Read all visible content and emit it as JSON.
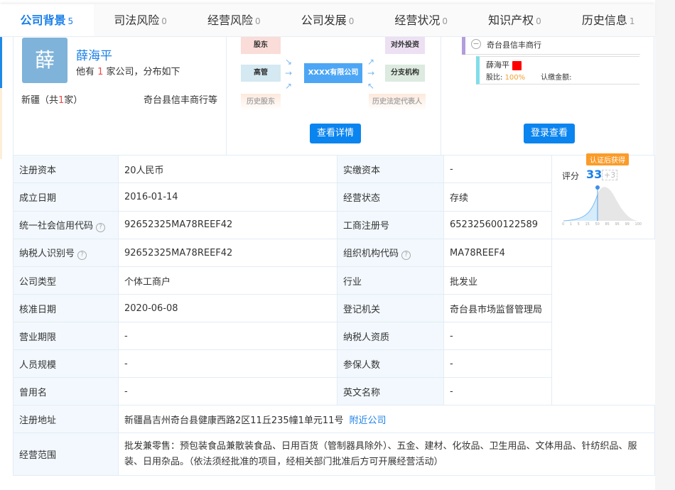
{
  "tabs": [
    {
      "label": "公司背景",
      "count": "5"
    },
    {
      "label": "司法风险",
      "count": "0"
    },
    {
      "label": "经营风险",
      "count": "0"
    },
    {
      "label": "公司发展",
      "count": "0"
    },
    {
      "label": "经营状况",
      "count": "0"
    },
    {
      "label": "知识产权",
      "count": "0"
    },
    {
      "label": "历史信息",
      "count": "1"
    }
  ],
  "person": {
    "avatar": "薛",
    "name": "薛海平",
    "desc_pre": "他有 ",
    "count": "1",
    "desc_post": " 家公司，分布如下",
    "region_pre": "新疆（共",
    "region_count": "1",
    "region_post": "家）",
    "companies": "奇台县信丰商行等"
  },
  "graph": {
    "shareholder": "股东",
    "executive": "高管",
    "history_shareholder": "历史股东",
    "center": "XXXX有限公司",
    "investment": "对外投资",
    "branch": "分支机构",
    "history_rep": "历史法定代表人",
    "button": "查看详情"
  },
  "equity": {
    "company": "奇台县信丰商行",
    "holder": "薛海平",
    "ratio_label": "股比: ",
    "ratio": "100%",
    "amount_label": "认缴金额:",
    "button": "登录查看"
  },
  "score": {
    "badge": "认证后获得",
    "label": "评分",
    "value": "33",
    "bonus": "+3",
    "ticks": [
      "0",
      "1",
      "5",
      "15",
      "50",
      "85",
      "95",
      "99",
      "100"
    ]
  },
  "rows": [
    [
      "注册资本",
      "20人民币",
      "实缴资本",
      "-"
    ],
    [
      "成立日期",
      "2016-01-14",
      "经营状态",
      "存续"
    ],
    [
      "统一社会信用代码",
      "92652325MA78REEF42",
      "工商注册号",
      "652325600122589"
    ],
    [
      "纳税人识别号",
      "92652325MA78REEF42",
      "组织机构代码",
      "MA78REEF4"
    ],
    [
      "公司类型",
      "个体工商户",
      "行业",
      "批发业"
    ],
    [
      "核准日期",
      "2020-06-08",
      "登记机关",
      "奇台县市场监督管理局"
    ],
    [
      "营业期限",
      "-",
      "纳税人资质",
      "-"
    ],
    [
      "人员规模",
      "-",
      "参保人数",
      "-"
    ],
    [
      "曾用名",
      "-",
      "英文名称",
      "-"
    ]
  ],
  "address": {
    "label": "注册地址",
    "value": "新疆昌吉州奇台县健康西路2区11丘235幢1单元11号",
    "link": "附近公司"
  },
  "scope": {
    "label": "经营范围",
    "value": "批发兼零售：预包装食品兼散装食品、日用百货（管制器具除外）、五金、建材、化妆品、卫生用品、文体用品、针纺织品、服装、日用杂品。（依法须经批准的项目，经相关部门批准后方可开展经营活动）"
  }
}
